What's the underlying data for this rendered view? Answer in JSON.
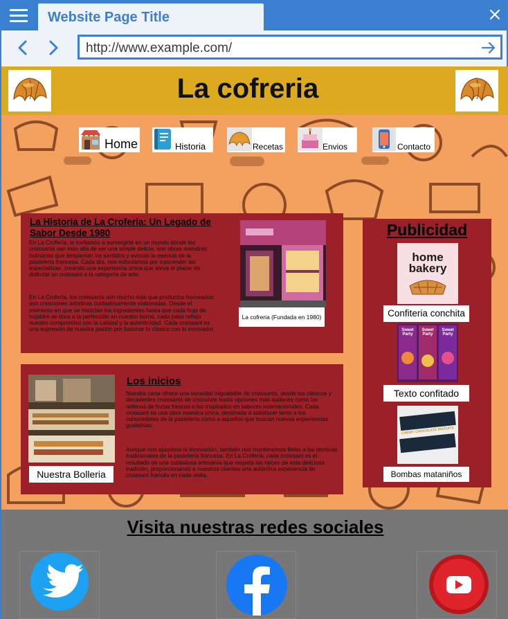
{
  "browser": {
    "tab_title": "Website Page Title",
    "url": "http://www.example.com/"
  },
  "site": {
    "title": "La cofreria"
  },
  "nav": {
    "items": [
      {
        "label": "Home",
        "icon": "bakery-shop-icon"
      },
      {
        "label": "Historia",
        "icon": "notebook-icon"
      },
      {
        "label": "Recetas",
        "icon": "croissant-icon"
      },
      {
        "label": "Envios",
        "icon": "cake-icon"
      },
      {
        "label": "Contacto",
        "icon": "phone-icon"
      }
    ]
  },
  "history": {
    "title": "La Historia de La Crofería: Un Legado de Sabor Desde 1980",
    "paragraph1": "En La Crofería, te invitamos a sumergirte en un mundo donde los croissants van más allá de ser una simple delicia; son obras maestras culinarias que despiertan los sentidos y evocan la esencia de la pastelería francesa. Cada día, nos esforzamos por trascender las expectativas, creando una experiencia única que eleva el placer de disfrutar un croissant a la categoría de arte.",
    "paragraph2": "En La Crofería, los croissants son mucho más que productos horneados; son creaciones artísticas cuidadosamente elaboradas. Desde el momento en que se mezclan los ingredientes hasta que cada hoja de hojaldre se dora a la perfección en nuestro horno, cada paso refleja nuestro compromiso con la calidad y la autenticidad. Cada croissant es una expresión de nuestra pasión por fusionar lo clásico con lo innovador.",
    "image_caption": "La cofreria (Fundada en 1980)"
  },
  "origins": {
    "title": "Los inicios",
    "paragraph1": "Nuestra carta ofrece una variedad inigualable de croissants, desde los clásicos y decadentes croissants de chocolate hasta opciones más audaces como los rellenos de frutas frescas o los inspirados en sabores internacionales. Cada croissant es una obra maestra única, destinada a satisfacer tanto a los conocedores de la pastelería como a aquellos que buscan nuevas experiencias gustativas.",
    "paragraph2": "Aunque nos apasiona la innovación, también nos mantenemos fieles a las técnicas tradicionales de la pastelería francesa. En La Crofería, cada croissant es el resultado de una cuidadosa artesanía que respeta las raíces de esta deliciosa tradición, proporcionando a nuestros clientes una auténtica experiencia de croissant francés en cada visita.",
    "image_caption": "Nuestra Bolleria"
  },
  "ads": {
    "title": "Publicidad",
    "items": [
      {
        "caption": "Confiteria conchita",
        "image_text": [
          "home",
          "bakery"
        ]
      },
      {
        "caption": "Texto confitado",
        "image_text": "Sweet Party"
      },
      {
        "caption": "Bombas mataniños",
        "image_text": "CHEWY CHOCOLATE BISCUITS"
      }
    ]
  },
  "footer": {
    "title": "Visita nuestras redes sociales",
    "networks": [
      "Twitter",
      "Facebook",
      "YouTube"
    ]
  },
  "colors": {
    "browser_blue": "#3b7fd1",
    "header_gold": "#dcaa20",
    "hero_orange": "#f4a15f",
    "box_red": "#9b2027",
    "footer_gray": "#777777"
  }
}
